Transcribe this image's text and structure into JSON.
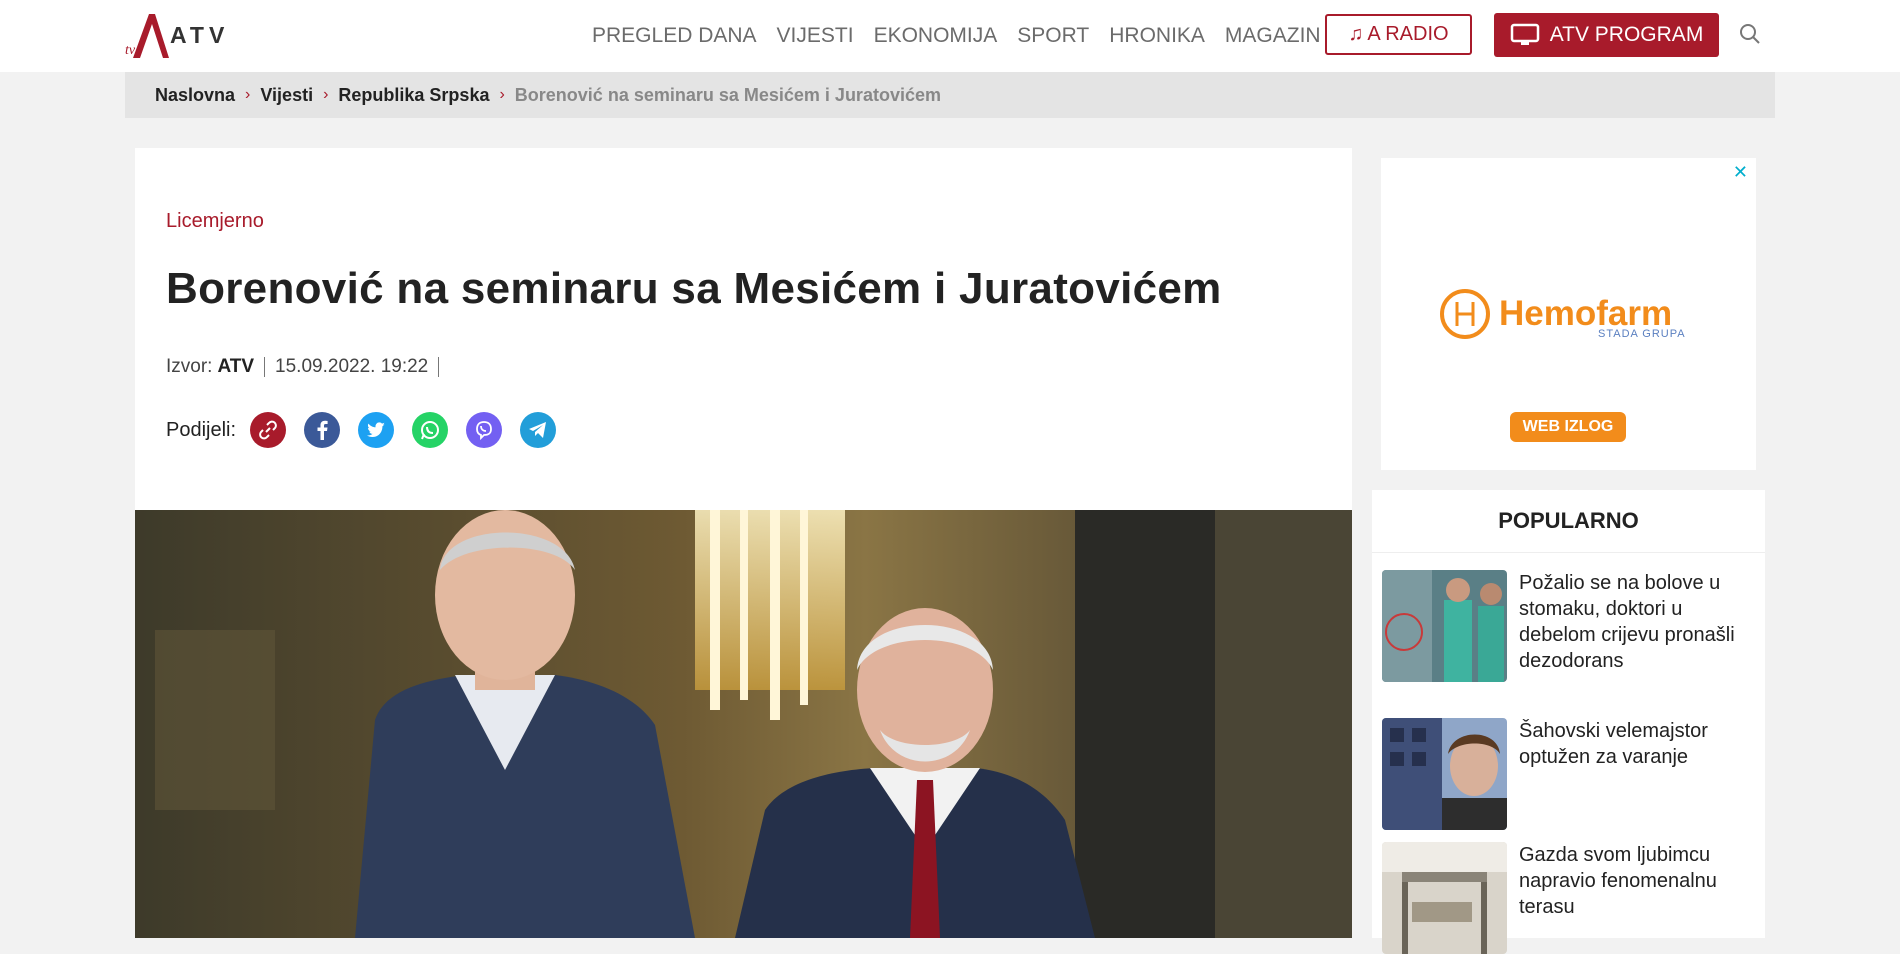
{
  "header": {
    "logo_text": "ATV",
    "nav": [
      "PREGLED DANA",
      "VIJESTI",
      "EKONOMIJA",
      "SPORT",
      "HRONIKA",
      "MAGAZIN"
    ],
    "radio_label": "A RADIO",
    "program_label": "ATV PROGRAM"
  },
  "breadcrumb": {
    "items": [
      "Naslovna",
      "Vijesti",
      "Republika Srpska"
    ],
    "current": "Borenović na seminaru sa Mesićem i Juratovićem"
  },
  "article": {
    "kicker": "Licemjerno",
    "title": "Borenović na seminaru sa Mesićem i Juratovićem",
    "source_label": "Izvor:",
    "source": "ATV",
    "date": "15.09.2022. 19:22",
    "share_label": "Podijeli:"
  },
  "ad": {
    "close": "✕",
    "brand": "Hemofarm",
    "sub": "STADA GRUPA",
    "button": "WEB IZLOG"
  },
  "popular": {
    "title": "POPULARNO",
    "items": [
      {
        "title": "Požalio se na bolove u stomaku, doktori u debelom crijevu pronašli dezodorans"
      },
      {
        "title": "Šahovski velemajstor optužen za varanje"
      },
      {
        "title": "Gazda svom ljubimcu napravio fenomenalnu terasu"
      }
    ]
  },
  "colors": {
    "brand": "#a81b2b",
    "ad_orange": "#f28c1b"
  }
}
